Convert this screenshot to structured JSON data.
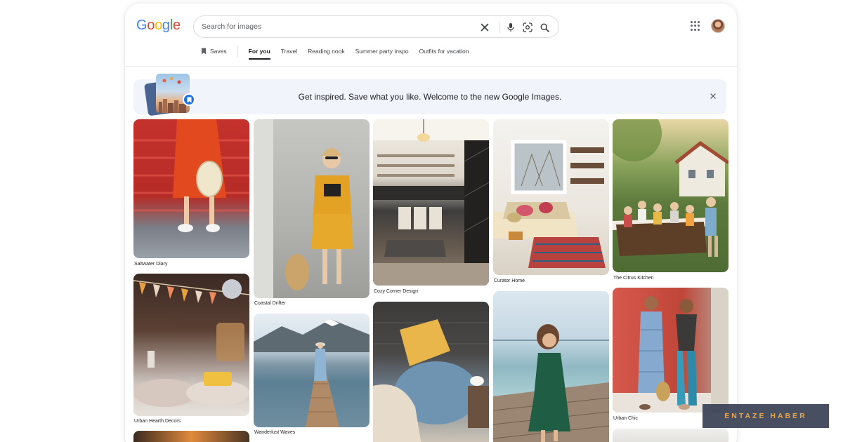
{
  "brand": {
    "logo_letters": [
      "G",
      "o",
      "o",
      "g",
      "l",
      "e"
    ],
    "logo_colors": [
      "#4285F4",
      "#EA4335",
      "#FBBC05",
      "#4285F4",
      "#34A853",
      "#EA4335"
    ]
  },
  "search": {
    "placeholder": "Search for images",
    "value": ""
  },
  "header_icons": [
    "clear-icon",
    "mic-icon",
    "lens-icon",
    "search-icon",
    "apps-icon",
    "avatar"
  ],
  "tabs": {
    "saves": "Saves",
    "items": [
      "For you",
      "Travel",
      "Reading nook",
      "Summer party inspo",
      "Outfits for vacation"
    ],
    "active": "For you"
  },
  "banner": {
    "text": "Get inspired. Save what you like. Welcome to the new Google Images."
  },
  "gallery": {
    "captions": [
      "Saltwater Diary",
      "Urban Hearth Decors",
      "Coastal Drifter",
      "Wanderlust Waves",
      "Cozy Corner Design",
      "Curator Home",
      "The Citrus Kitchen",
      "Urban Chic"
    ]
  },
  "watermark": {
    "text": "ENTAZE HABER"
  },
  "colors": {
    "accent": "#1a73e8",
    "text": "#202124",
    "muted": "#5f6368",
    "banner_bg": "#f1f4fa"
  }
}
